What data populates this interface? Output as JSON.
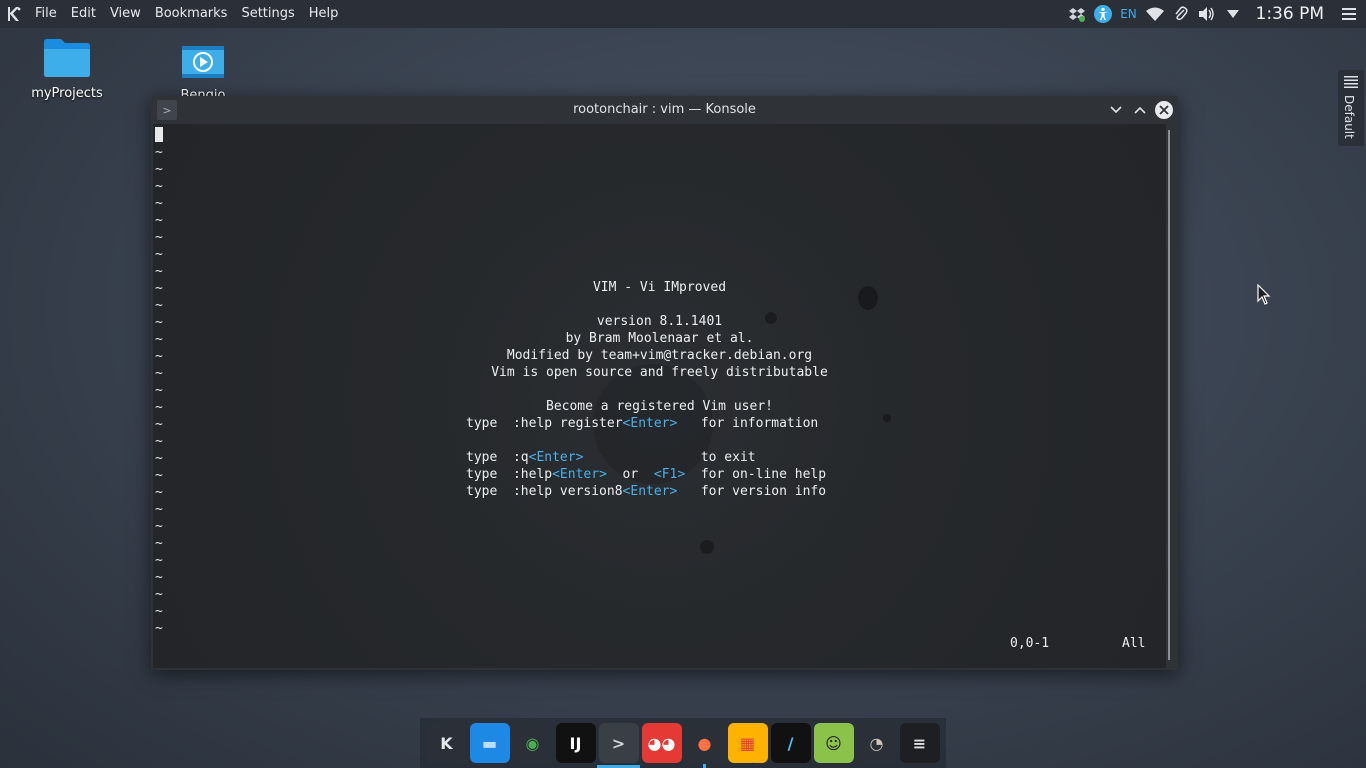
{
  "menubar": {
    "items": [
      "File",
      "Edit",
      "View",
      "Bookmarks",
      "Settings",
      "Help"
    ]
  },
  "tray": {
    "language": "EN",
    "clock": "1:36 PM",
    "icons": [
      "dropbox-icon",
      "accessibility-icon",
      "wifi-icon",
      "paperclip-icon",
      "volume-icon",
      "expand-arrow-icon",
      "hamburger-menu-icon"
    ]
  },
  "desktop": {
    "icons": [
      {
        "label": "myProjects",
        "icon": "folder-icon"
      },
      {
        "label": "Bengio",
        "icon": "video-file-icon"
      }
    ]
  },
  "konsole": {
    "title": "rootonchair : vim — Konsole",
    "app_icon_glyph": ">",
    "tilde_char": "~",
    "splash": {
      "title": "VIM - Vi IMproved",
      "version": "version 8.1.1401",
      "author": "by Bram Moolenaar et al.",
      "modified": "Modified by team+vim@tracker.debian.org",
      "license": "Vim is open source and freely distributable",
      "register_heading": "Become a registered Vim user!",
      "lines": [
        {
          "type": "type",
          "cmd": ":help register",
          "key": "<Enter>",
          "gap": "   ",
          "desc": "for information"
        },
        {
          "type": "type",
          "cmd": ":q",
          "key": "<Enter>",
          "gap": "               ",
          "desc": "to exit"
        },
        {
          "type": "type",
          "cmd": ":help",
          "key": "<Enter>",
          "or": "  or  ",
          "key2": "<F1>",
          "gap": "  ",
          "desc": "for on-line help"
        },
        {
          "type": "type",
          "cmd": ":help version8",
          "key": "<Enter>",
          "gap": "   ",
          "desc": "for version info"
        }
      ]
    },
    "status": {
      "position": "0,0-1",
      "scroll": "All"
    }
  },
  "right_widget": {
    "label": "Default"
  },
  "dock": {
    "items": [
      {
        "name": "kde-icon",
        "glyph": "K",
        "bg": "#2b3038",
        "fg": "#e6e9ec"
      },
      {
        "name": "files-icon",
        "glyph": "▬",
        "bg": "#1e88e5",
        "fg": "#bbdefb"
      },
      {
        "name": "chrome-icon",
        "glyph": "◉",
        "bg": "#2b3038",
        "fg": "#4caf50"
      },
      {
        "name": "intellij-icon",
        "glyph": "IJ",
        "bg": "#111111",
        "fg": "#ffffff"
      },
      {
        "name": "terminal-icon",
        "glyph": ">",
        "bg": "#3a3f45",
        "fg": "#d0d4d8"
      },
      {
        "name": "ghost-icon",
        "glyph": "◕◕",
        "bg": "#e53935",
        "fg": "#ffffff"
      },
      {
        "name": "firefox-icon",
        "glyph": "●",
        "bg": "#2b3038",
        "fg": "#ff7043"
      },
      {
        "name": "tiles-icon",
        "glyph": "▦",
        "bg": "#ffb300",
        "fg": "#e53935"
      },
      {
        "name": "pen-icon",
        "glyph": "/",
        "bg": "#111111",
        "fg": "#4fc3f7"
      },
      {
        "name": "frog-icon",
        "glyph": "☺",
        "bg": "#8bc34a",
        "fg": "#1b1b1b"
      },
      {
        "name": "gimp-icon",
        "glyph": "◔",
        "bg": "#2b3038",
        "fg": "#cfc6b5"
      },
      {
        "name": "settings-sliders-icon",
        "glyph": "≡",
        "bg": "#1d1f22",
        "fg": "#e0e0e0"
      }
    ]
  }
}
